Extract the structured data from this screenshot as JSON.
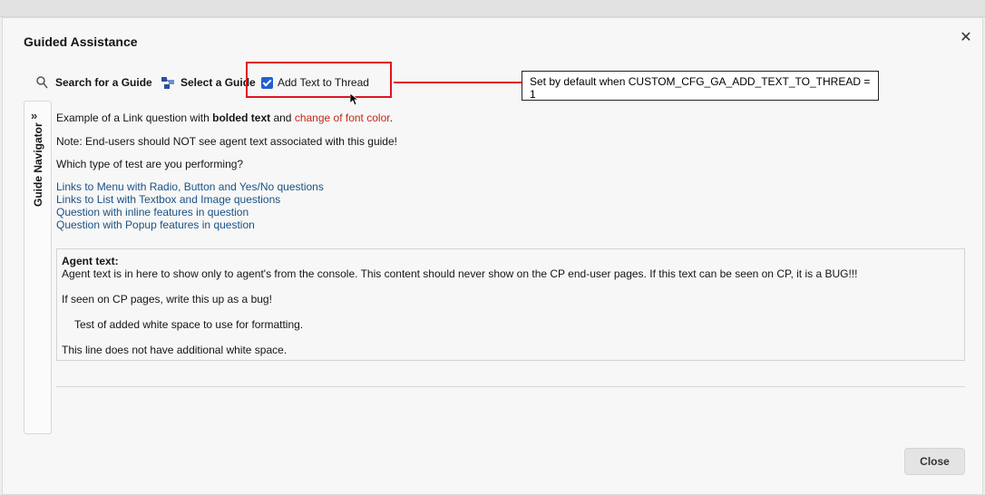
{
  "dialog": {
    "title": "Guided Assistance",
    "close_icon": "close-icon"
  },
  "toolbar": {
    "search_label": "Search for a Guide",
    "select_label": "Select a Guide",
    "add_text_label": "Add Text to Thread",
    "add_text_checked": true
  },
  "annotation": {
    "note": "Set by default when CUSTOM_CFG_GA_ADD_TEXT_TO_THREAD = 1",
    "highlight_color": "#e3131f"
  },
  "navigator": {
    "label": "Guide Navigator",
    "expand_icon": "double-chevron-right-icon"
  },
  "question": {
    "intro_pre": "Example of a Link question with ",
    "intro_bold": "bolded text",
    "intro_mid": " and ",
    "intro_red": "change of font color",
    "intro_end": ".",
    "note": "Note:  End-users should NOT see agent text associated with this guide!",
    "prompt": "Which type of test are you performing?",
    "links": [
      "Links to Menu with Radio, Button and Yes/No questions",
      "Links to List with Textbox and Image questions",
      "Question with inline features in question",
      "Question with Popup features in question"
    ]
  },
  "agent": {
    "heading": "Agent text:",
    "line1": "Agent text is in here to show only to agent's from the console.  This content should never show on the CP end-user pages.  If this text can be seen on CP, it is a BUG!!!",
    "line2": "If seen on CP pages, write this up as a bug!",
    "line3": "Test of added white space to use for formatting.",
    "line4": "This line does not have additional white space."
  },
  "footer": {
    "close_label": "Close"
  },
  "colors": {
    "link": "#1a5283",
    "red_text": "#c0281c",
    "checkbox": "#1f5fd1"
  }
}
